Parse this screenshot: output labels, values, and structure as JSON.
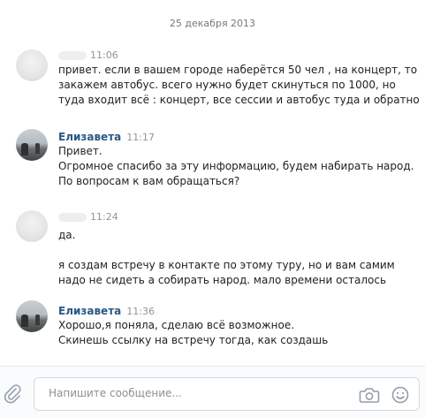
{
  "chat": {
    "date": "25 декабря 2013",
    "messages": [
      {
        "author": "",
        "time": "11:06",
        "text": "привет. если в вашем городе наберётся 50 чел , на концерт, то\nзакажем автобус. всего нужно будет скинуться по 1000, но\nтуда входит всё : концерт, все сессии и автобус туда и обратно"
      },
      {
        "author": "Елизавета",
        "time": "11:17",
        "text": "Привет.\nОгромное спасибо за эту информацию, будем набирать народ.\nПо вопросам к вам обращаться?"
      },
      {
        "author": "",
        "time": "11:24",
        "text": "да.\n\nя создам встречу в контакте по этому туру, но и вам самим\nнадо не сидеть а собирать народ. мало времени осталось"
      },
      {
        "author": "Елизавета",
        "time": "11:36",
        "text": "Хорошо,я поняла, сделаю всё возможное.\nСкинешь ссылку на встречу тогда, как создашь"
      }
    ]
  },
  "composer": {
    "placeholder": "Напишите сообщение...",
    "value": ""
  },
  "icons": {
    "attach": "paperclip-icon",
    "camera": "camera-icon",
    "emoji": "smile-icon"
  }
}
